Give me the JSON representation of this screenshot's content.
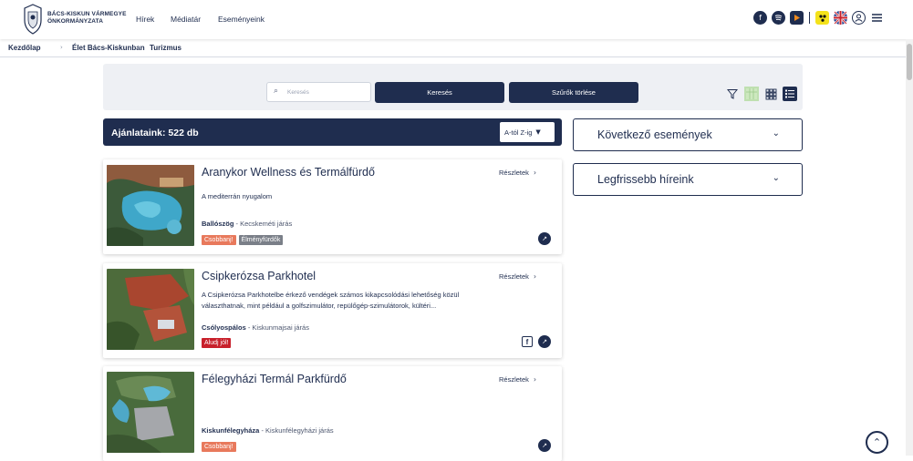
{
  "header": {
    "logo_line1": "BÁCS-KISKUN VÁRMEGYE",
    "logo_line2": "ÖNKORMÁNYZATA",
    "nav": [
      "Hírek",
      "Médiatár",
      "Eseményeink"
    ]
  },
  "header_icons": [
    "facebook-icon",
    "spotify-icon",
    "youtube-icon",
    "accessibility-icon",
    "uk-flag-icon",
    "user-icon",
    "menu-icon"
  ],
  "breadcrumb": [
    "Kezdőlap",
    "Élet Bács-Kiskunban",
    "Turizmus"
  ],
  "filter": {
    "search_placeholder": "Keresés",
    "search_button": "Keresés",
    "clear_button": "Szűrők törlése"
  },
  "results": {
    "label": "Ajánlataink: 522 db",
    "sort": "A-tól Z-ig"
  },
  "cards": [
    {
      "title": "Aranykor Wellness és Termálfürdő",
      "details": "Részletek",
      "desc": "A mediterrán nyugalom",
      "place": "Ballószög",
      "district": " - Kecskeméti járás",
      "tags": [
        "Csobbanj!",
        "Élményfürdők"
      ]
    },
    {
      "title": "Csipkerózsa Parkhotel",
      "details": "Részletek",
      "desc": "A Csipkerózsa Parkhotelbe érkező vendégek számos kikapcsolódási lehetőség közül választhatnak, mint például a golfszimulátor, repülőgép-szimulátorok, kültéri...",
      "place": "Csólyospálos",
      "district": " - Kiskunmajsai járás",
      "tags": [
        "Aludj jól!"
      ]
    },
    {
      "title": "Félegyházi Termál Parkfürdő",
      "details": "Részletek",
      "desc": "",
      "place": "Kiskunfélegyháza",
      "district": " - Kiskunfélegyházi járás",
      "tags": [
        "Csobbanj!"
      ]
    }
  ],
  "sidebar": [
    "Következő események",
    "Legfrissebb híreink"
  ],
  "colors": {
    "navy": "#1f2d4f",
    "tag_csobbanj": "#e8795c",
    "tag_elmeny": "#7a7f88",
    "tag_aludj": "#c8202b"
  }
}
